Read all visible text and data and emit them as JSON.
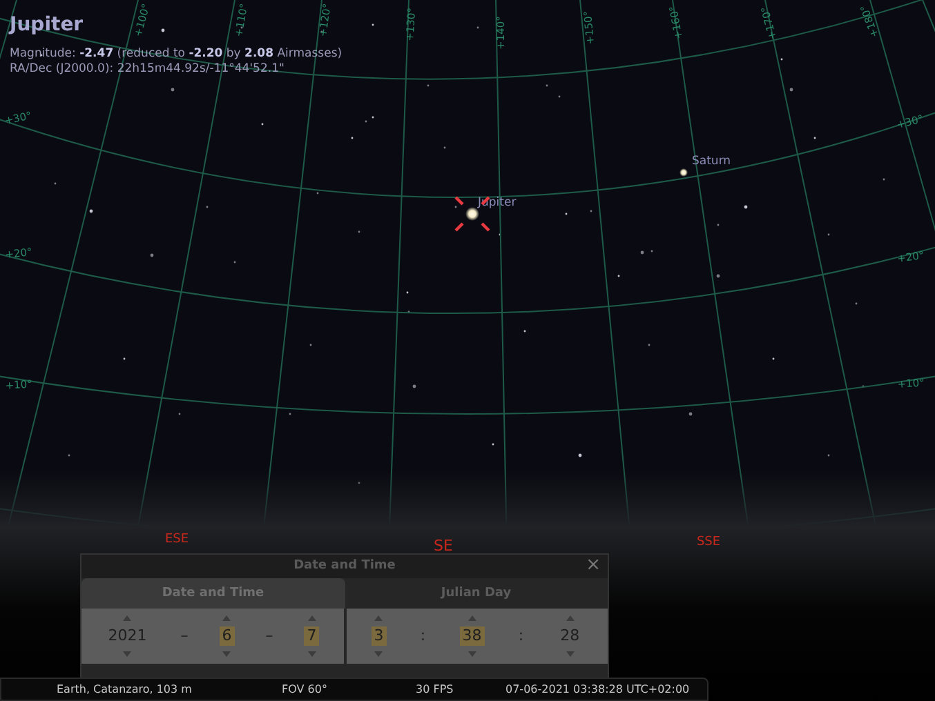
{
  "info_panel": {
    "title": "Jupiter",
    "lines": [
      "Magnitude: **-2.47** (reduced to **-2.20** by **2.08** Airmasses)",
      "RA/Dec (J2000.0): 22h15m44.92s/-11°44'52.1\""
    ]
  },
  "sky": {
    "meridian_labels": [
      "+100°",
      "+110°",
      "+120°",
      "+130°",
      "+140°",
      "+150°",
      "+160°",
      "+170°",
      "+180°"
    ],
    "parallel_labels_left": [
      "+30°",
      "+20°",
      "+10°"
    ],
    "parallel_labels_right": [
      "+30°",
      "+20°",
      "+10°"
    ],
    "objects": [
      {
        "label": "Jupiter",
        "selected": true
      },
      {
        "label": "Saturn",
        "selected": false
      }
    ],
    "compass": [
      "ESE",
      "SE",
      "SSE"
    ]
  },
  "dialog": {
    "title": "Date and Time",
    "close": "×",
    "tabs": [
      {
        "label": "Date and Time",
        "selected": true
      },
      {
        "label": "Julian Day",
        "selected": false
      }
    ],
    "date": {
      "fields": [
        {
          "value": "2021",
          "highlighted": false
        },
        {
          "value": "6",
          "highlighted": true
        },
        {
          "value": "7",
          "highlighted": true
        }
      ],
      "separators": [
        "–",
        "–"
      ]
    },
    "time": {
      "fields": [
        {
          "value": "3",
          "highlighted": true
        },
        {
          "value": "38",
          "highlighted": true
        },
        {
          "value": "28",
          "highlighted": false
        }
      ],
      "separators": [
        ":",
        ":"
      ]
    }
  },
  "status_bar": {
    "location": "Earth, Catanzaro, 103 m",
    "fov": "FOV 60°",
    "fps": "30 FPS",
    "datetime": "07-06-2021 03:38:28 UTC+02:00"
  }
}
